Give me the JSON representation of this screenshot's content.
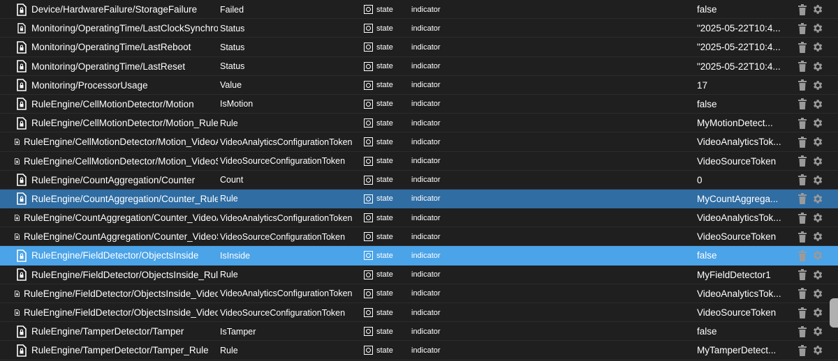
{
  "rows": [
    {
      "id": "Device/HardwareFailure/StorageFailure",
      "name": "Failed",
      "type": "state",
      "role": "indicator",
      "value": "false",
      "icon_size": "large",
      "selected": ""
    },
    {
      "id": "Monitoring/OperatingTime/LastClockSynchro",
      "name": "Status",
      "type": "state",
      "role": "indicator",
      "value": "\"2025-05-22T10:4...",
      "icon_size": "medium",
      "selected": ""
    },
    {
      "id": "Monitoring/OperatingTime/LastReboot",
      "name": "Status",
      "type": "state",
      "role": "indicator",
      "value": "\"2025-05-22T10:4...",
      "icon_size": "large",
      "selected": ""
    },
    {
      "id": "Monitoring/OperatingTime/LastReset",
      "name": "Status",
      "type": "state",
      "role": "indicator",
      "value": "\"2025-05-22T10:4...",
      "icon_size": "large",
      "selected": ""
    },
    {
      "id": "Monitoring/ProcessorUsage",
      "name": "Value",
      "type": "state",
      "role": "indicator",
      "value": "17",
      "icon_size": "large",
      "selected": ""
    },
    {
      "id": "RuleEngine/CellMotionDetector/Motion",
      "name": "IsMotion",
      "type": "state",
      "role": "indicator",
      "value": "false",
      "icon_size": "large",
      "selected": ""
    },
    {
      "id": "RuleEngine/CellMotionDetector/Motion_Rule",
      "name": "Rule",
      "type": "state",
      "role": "indicator",
      "value": "MyMotionDetect...",
      "icon_size": "large",
      "selected": ""
    },
    {
      "id": "RuleEngine/CellMotionDetector/Motion_VideoAnalyticsConfigurationToken",
      "name": "VideoAnalyticsConfigurationToken",
      "type": "state",
      "role": "indicator",
      "value": "VideoAnalyticsTok...",
      "icon_size": "small",
      "selected": ""
    },
    {
      "id": "RuleEngine/CellMotionDetector/Motion_VideoSourceConfigurationToken",
      "name": "VideoSourceConfigurationToken",
      "type": "state",
      "role": "indicator",
      "value": "VideoSourceToken",
      "icon_size": "small",
      "selected": ""
    },
    {
      "id": "RuleEngine/CountAggregation/Counter",
      "name": "Count",
      "type": "state",
      "role": "indicator",
      "value": "0",
      "icon_size": "large",
      "selected": ""
    },
    {
      "id": "RuleEngine/CountAggregation/Counter_Rule",
      "name": "Rule",
      "type": "state",
      "role": "indicator",
      "value": "MyCountAggrega...",
      "icon_size": "large",
      "selected": "dark"
    },
    {
      "id": "RuleEngine/CountAggregation/Counter_VideoAnalyticsConfigurationToken",
      "name": "VideoAnalyticsConfigurationToken",
      "type": "state",
      "role": "indicator",
      "value": "VideoAnalyticsTok...",
      "icon_size": "small",
      "selected": ""
    },
    {
      "id": "RuleEngine/CountAggregation/Counter_VideoSourceConfigurationToken",
      "name": "VideoSourceConfigurationToken",
      "type": "state",
      "role": "indicator",
      "value": "VideoSourceToken",
      "icon_size": "small",
      "selected": ""
    },
    {
      "id": "RuleEngine/FieldDetector/ObjectsInside",
      "name": "IsInside",
      "type": "state",
      "role": "indicator",
      "value": "false",
      "icon_size": "large",
      "selected": "light"
    },
    {
      "id": "RuleEngine/FieldDetector/ObjectsInside_Rule",
      "name": "Rule",
      "type": "state",
      "role": "indicator",
      "value": "MyFieldDetector1",
      "icon_size": "large",
      "selected": ""
    },
    {
      "id": "RuleEngine/FieldDetector/ObjectsInside_VideoAnalyticsConfigurationToken",
      "name": "VideoAnalyticsConfigurationToken",
      "type": "state",
      "role": "indicator",
      "value": "VideoAnalyticsTok...",
      "icon_size": "small",
      "selected": ""
    },
    {
      "id": "RuleEngine/FieldDetector/ObjectsInside_VideoSourceConfigurationToken",
      "name": "VideoSourceConfigurationToken",
      "type": "state",
      "role": "indicator",
      "value": "VideoSourceToken",
      "icon_size": "small",
      "selected": ""
    },
    {
      "id": "RuleEngine/TamperDetector/Tamper",
      "name": "IsTamper",
      "type": "state",
      "role": "indicator",
      "value": "false",
      "icon_size": "large",
      "selected": ""
    },
    {
      "id": "RuleEngine/TamperDetector/Tamper_Rule",
      "name": "Rule",
      "type": "state",
      "role": "indicator",
      "value": "MyTamperDetect...",
      "icon_size": "large",
      "selected": ""
    }
  ],
  "icons": {
    "row_icon": "file-icon",
    "type_icon": "state-type-icon",
    "delete": "trash-icon",
    "settings": "gear-icon"
  },
  "colors": {
    "background": "#1f1f1f",
    "selected_dark": "#2f6da3",
    "selected_light": "#4ba3e8",
    "action_icon": "#9a9a9a"
  }
}
